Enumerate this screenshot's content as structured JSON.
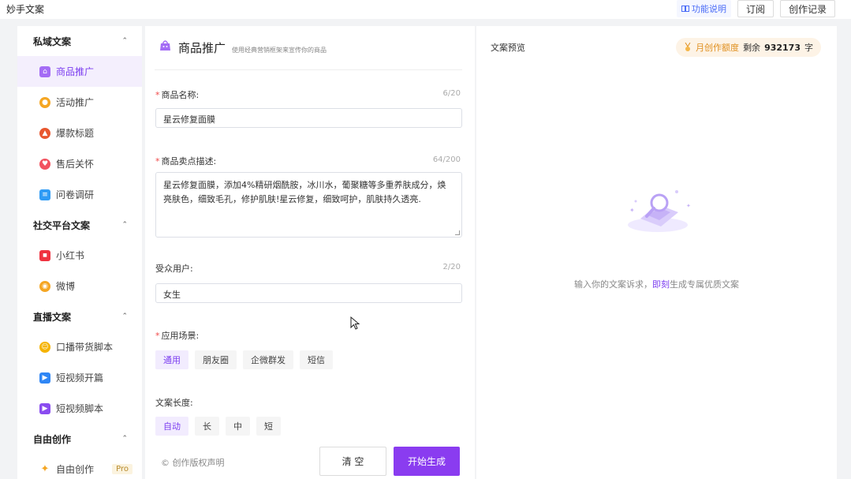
{
  "app": {
    "title": "妙手文案"
  },
  "topbar": {
    "func_label": "功能说明",
    "subscribe_label": "订阅",
    "history_label": "创作记录"
  },
  "sidebar": {
    "groups": [
      {
        "title": "私域文案",
        "items": [
          "商品推广",
          "活动推广",
          "爆款标题",
          "售后关怀",
          "问卷调研"
        ]
      },
      {
        "title": "社交平台文案",
        "items": [
          "小红书",
          "微博"
        ]
      },
      {
        "title": "直播文案",
        "items": [
          "口播带货脚本",
          "短视频开篇",
          "短视频脚本"
        ]
      },
      {
        "title": "自由创作",
        "items": [
          "自由创作"
        ]
      }
    ],
    "pro_badge": "Pro",
    "active_item": "商品推广"
  },
  "form": {
    "title": "商品推广",
    "subtitle": "使用经典营销框架来宣传你的商品",
    "name": {
      "label": "商品名称:",
      "count": "6/20",
      "value": "星云修复面膜"
    },
    "desc": {
      "label": "商品卖点描述:",
      "count": "64/200",
      "value": "星云修复面膜，添加4%精研烟酰胺，冰川水，葡聚糖等多重养肤成分，焕亮肤色，细致毛孔，修护肌肤!星云修复，细致呵护，肌肤持久透亮."
    },
    "audience": {
      "label": "受众用户:",
      "count": "2/20",
      "value": "女生"
    },
    "scene": {
      "label": "应用场景:",
      "options": [
        "通用",
        "朋友圈",
        "企微群发",
        "短信"
      ],
      "selected": "通用"
    },
    "length": {
      "label": "文案长度:",
      "options": [
        "自动",
        "长",
        "中",
        "短"
      ],
      "selected": "自动"
    },
    "copyright": "© 创作版权声明",
    "clear_label": "清 空",
    "generate_label": "开始生成"
  },
  "preview": {
    "title": "文案预览",
    "quota_label": "月创作额度",
    "quota_prefix": "剩余",
    "quota_value": "932173",
    "quota_unit": "字",
    "empty_hint_pre": "输入你的文案诉求，",
    "empty_hint_accent": "即刻",
    "empty_hint_post": "生成专属优质文案"
  },
  "colors": {
    "accent": "#8a3cf0",
    "active_bg": "#f4effd",
    "required": "#f04848"
  }
}
